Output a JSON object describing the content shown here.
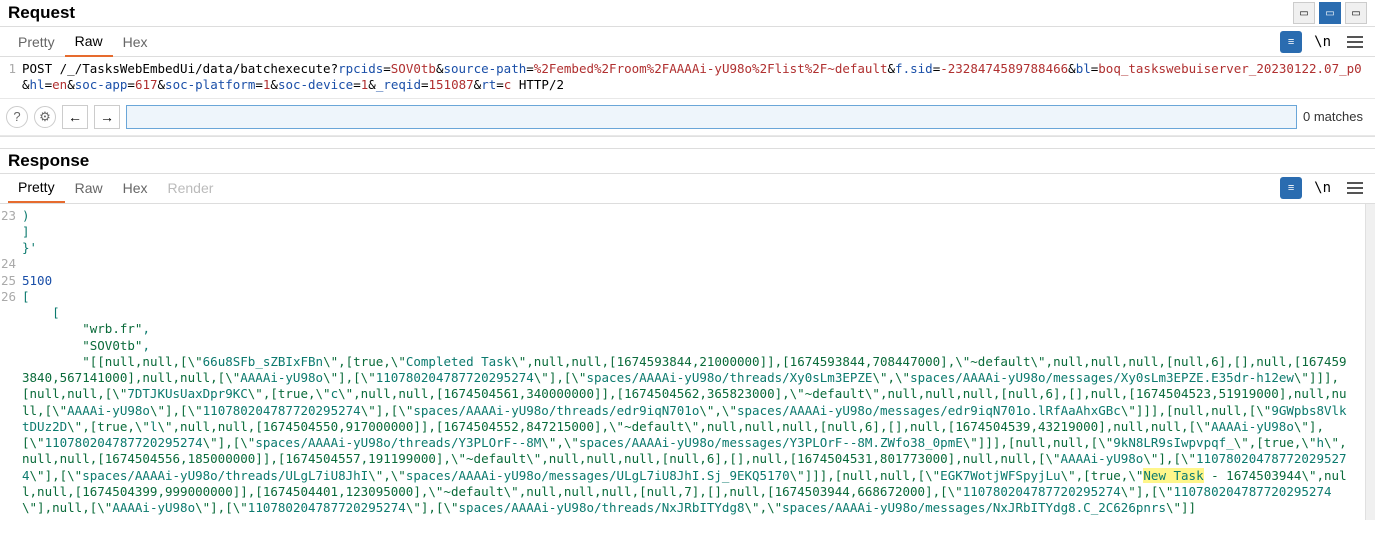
{
  "request": {
    "title": "Request",
    "tabs": [
      "Pretty",
      "Raw",
      "Hex"
    ],
    "active_tab": 1,
    "line_no": "1",
    "method": "POST ",
    "path": "/_/TasksWebEmbedUi/data/batchexecute?",
    "params": [
      {
        "k": "rpcids",
        "v": "SOV0tb"
      },
      {
        "k": "source-path",
        "v": "%2Fembed%2Froom%2FAAAAi-yU98o%2Flist%2F~default"
      },
      {
        "k": "f.sid",
        "v": "-2328474589788466"
      },
      {
        "k": "bl",
        "v": "boq_taskswebuiserver_20230122.07_p0"
      },
      {
        "k": "hl",
        "v": "en"
      },
      {
        "k": "soc-app",
        "v": "617"
      },
      {
        "k": "soc-platform",
        "v": "1"
      },
      {
        "k": "soc-device",
        "v": "1"
      },
      {
        "k": "_reqid",
        "v": "151087"
      },
      {
        "k": "rt",
        "v": "c"
      }
    ],
    "proto": " HTTP/2",
    "newline_label": "\\n",
    "search": {
      "matches": "0 matches"
    }
  },
  "response": {
    "title": "Response",
    "tabs": [
      "Pretty",
      "Raw",
      "Hex",
      "Render"
    ],
    "active_tab": 0,
    "newline_label": "\\n",
    "lines": {
      "l23a": ")",
      "l23b": "]",
      "l23c": "}'",
      "l24": "",
      "l25": "5100",
      "l26a": "[",
      "l26b": "    [",
      "str_wrb": "\"wrb.fr\"",
      "str_sov": "\"SOV0tb\"",
      "comma": ",",
      "body_pre1": "        \"[[null,null,[\\\"",
      "t_66u": "66u8SFb_sZBIxFBn",
      "body_s1": "\\\",[true,\\\"",
      "t_completed": "Completed Task",
      "body_s2": "\\\",null,null,[1674593844,21000000]],[1674593844,708447000],\\\"~default\\\",null,null,null,[null,6],[],null,[1674593840,567141000],null,null,[\\\"",
      "t_aa": "AAAAi-yU98o",
      "body_s3": "\\\"],[\\\"",
      "t_id1": "110780204787720295274",
      "body_s4": "\\\"],[\\\"",
      "t_sp1": "spaces/AAAAi-yU98o/threads/Xy0sLm3EPZE",
      "body_s5": "\\\",\\\"",
      "t_sp2": "spaces/AAAAi-yU98o/messages/Xy0sLm3EPZE.E35dr-h12ew",
      "body_s6": "\\\"]]],[null,null,[\\\"",
      "t_7d": "7DTJKUsUaxDpr9KC",
      "body_s7": "\\\",[true,\\\"",
      "t_c": "c",
      "body_s8": "\\\",null,null,[1674504561,340000000]],[1674504562,365823000],\\\"~default\\\",null,null,null,[null,6],[],null,[1674504523,51919000],null,null,[\\\"",
      "body_s9": "\\\"],[\\\"",
      "body_s10": "\\\"],[\\\"",
      "t_sp3": "spaces/AAAAi-yU98o/threads/edr9iqN701o",
      "body_s11": "\\\",\\\"",
      "t_sp4": "spaces/AAAAi-yU98o/messages/edr9iqN701o.lRfAaAhxGBc",
      "body_s12": "\\\"]]],[null,null,[\\\"",
      "t_9g": "9GWpbs8VlktDUz2D",
      "body_s13": "\\\",[true,\\\"",
      "t_l": "l",
      "body_s14": "\\\",null,null,[1674504550,917000000]],[1674504552,847215000],\\\"~default\\\",null,null,null,[null,6],[],null,[1674504539,43219000],null,null,[\\\"",
      "t_aa2": "AAAAi-yU98o",
      "body_s15": "\\\"],[\\\"",
      "body_s16": "\\\"],[\\\"",
      "t_sp5": "spaces/AAAAi-yU98o/threads/Y3PLOrF--8M",
      "body_s17": "\\\",\\\"",
      "t_sp6": "spaces/AAAAi-yU98o/messages/Y3PLOrF--8M.ZWfo38_0pmE",
      "body_s18": "\\\"]]],[null,null,[\\\"",
      "t_9k": "9kN8LR9sIwpvpqf_",
      "body_s19": "\\\",[true,\\\"",
      "t_h": "h",
      "body_s20": "\\\",null,null,[1674504556,185000000]],[1674504557,191199000],\\\"~default\\\",null,null,null,[null,6],[],null,[1674504531,801773000],null,null,[\\\"",
      "body_s21": "\\\"],[\\\"",
      "body_s22": "\\\"],[\\\"",
      "t_sp7": "spaces/AAAAi-yU98o/threads/ULgL7iU8JhI",
      "body_s23": "\\\",\\\"",
      "t_sp8": "spaces/AAAAi-yU98o/messages/ULgL7iU8JhI.Sj_9EKQ5170",
      "body_s24": "\\\"]]],[null,null,[\\\"",
      "t_eg": "EGK7WotjWFSpyjLu",
      "body_s25": "\\\",[true,\\\"",
      "t_new": "New Task",
      "body_s26": " - 1674503944\\\",null,null,[1674504399,999000000]],[1674504401,123095000],\\\"~default\\\",null,null,null,[null,7],[],null,[1674503944,668672000],[\\\"",
      "body_s27": "\\\"],[\\\"",
      "body_s28": "\\\"],null,[\\\"",
      "body_s29": "\\\"],[\\\"",
      "body_s30": "\\\"],[\\\"",
      "t_sp9": "spaces/AAAAi-yU98o/threads/NxJRbITYdg8",
      "body_s31": "\\\",\\\"",
      "t_sp10": "spaces/AAAAi-yU98o/messages/NxJRbITYdg8.C_2C626pnrs",
      "body_s32": "\\\"]]"
    }
  }
}
